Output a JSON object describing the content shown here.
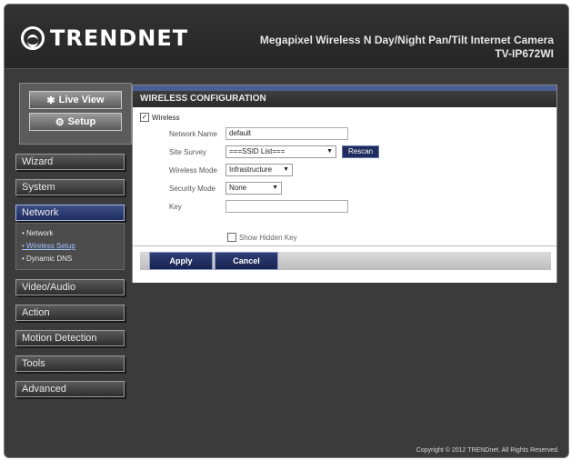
{
  "header": {
    "brand": "TRENDNET",
    "product_line": "Megapixel Wireless N Day/Night Pan/Tilt Internet Camera",
    "model": "TV-IP672WI"
  },
  "top_nav": {
    "live_view": "Live View",
    "setup": "Setup"
  },
  "sidebar": {
    "menus": [
      {
        "label": "Wizard"
      },
      {
        "label": "System"
      },
      {
        "label": "Network"
      },
      {
        "label": "Video/Audio"
      },
      {
        "label": "Action"
      },
      {
        "label": "Motion Detection"
      },
      {
        "label": "Tools"
      },
      {
        "label": "Advanced"
      }
    ],
    "network_submenu": [
      {
        "label": "Network"
      },
      {
        "label": "Wireless Setup"
      },
      {
        "label": "Dynamic DNS"
      }
    ]
  },
  "panel": {
    "title": "WIRELESS CONFIGURATION",
    "wireless_label": "Wireless",
    "wireless_checked": "✓",
    "network_name_label": "Network Name",
    "network_name_value": "default",
    "site_survey_label": "Site Survey",
    "site_survey_value": "===SSID List===",
    "rescan_label": "Rescan",
    "wireless_mode_label": "Wireless Mode",
    "wireless_mode_value": "Infrastructure",
    "security_mode_label": "Security Mode",
    "security_mode_value": "None",
    "key_label": "Key",
    "key_value": "",
    "show_hidden_key_label": "Show Hidden Key"
  },
  "actions": {
    "apply": "Apply",
    "cancel": "Cancel"
  },
  "footer": {
    "copyright": "Copyright © 2012 TRENDnet. All Rights Reserved."
  }
}
